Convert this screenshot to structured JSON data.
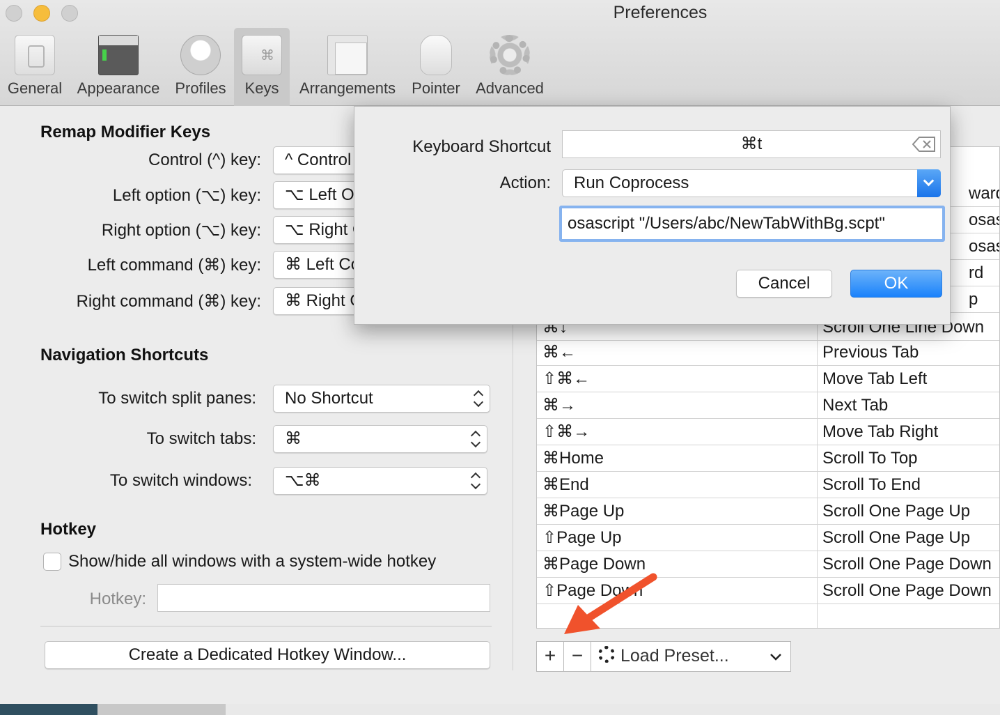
{
  "window": {
    "title": "Preferences"
  },
  "toolbar": {
    "items": [
      {
        "label": "General",
        "icon": "general-icon"
      },
      {
        "label": "Appearance",
        "icon": "appearance-icon"
      },
      {
        "label": "Profiles",
        "icon": "profiles-icon"
      },
      {
        "label": "Keys",
        "icon": "keys-icon",
        "selected": true,
        "glyph": "⌘"
      },
      {
        "label": "Arrangements",
        "icon": "arrangements-icon"
      },
      {
        "label": "Pointer",
        "icon": "pointer-icon"
      },
      {
        "label": "Advanced",
        "icon": "gear-icon"
      }
    ]
  },
  "remap": {
    "title": "Remap Modifier Keys",
    "rows": [
      {
        "label": "Control (^) key:",
        "value": "^ Control"
      },
      {
        "label": "Left option (⌥) key:",
        "value": "⌥ Left Option"
      },
      {
        "label": "Right option (⌥) key:",
        "value": "⌥ Right Option"
      },
      {
        "label": "Left command (⌘) key:",
        "value": "⌘ Left Command"
      },
      {
        "label": "Right command (⌘) key:",
        "value": "⌘ Right Command"
      }
    ]
  },
  "navigation": {
    "title": "Navigation Shortcuts",
    "rows": [
      {
        "label": "To switch split panes:",
        "value": "No Shortcut"
      },
      {
        "label": "To switch tabs:",
        "value": "⌘"
      },
      {
        "label": "To switch windows:",
        "value": "⌥⌘"
      }
    ]
  },
  "hotkey": {
    "title": "Hotkey",
    "checkbox_label": "Show/hide all windows with a system-wide hotkey",
    "field_label": "Hotkey:",
    "field_value": "",
    "dedicated_button": "Create a Dedicated Hotkey Window..."
  },
  "key_table": {
    "partial_rows": [
      {
        "key": "",
        "action": "ward"
      },
      {
        "key": "",
        "action": "osas"
      },
      {
        "key": "",
        "action": "osas"
      },
      {
        "key": "",
        "action": "rd"
      },
      {
        "key": "",
        "action": "p"
      },
      {
        "key": "⌘↓",
        "action": "Scroll One Line Down"
      }
    ],
    "rows": [
      {
        "key": "⌘←",
        "action": "Previous Tab"
      },
      {
        "key": "⇧⌘←",
        "action": "Move Tab Left"
      },
      {
        "key": "⌘→",
        "action": "Next Tab"
      },
      {
        "key": "⇧⌘→",
        "action": "Move Tab Right"
      },
      {
        "key": "⌘Home",
        "action": "Scroll To Top"
      },
      {
        "key": "⌘End",
        "action": "Scroll To End"
      },
      {
        "key": "⌘Page Up",
        "action": "Scroll One Page Up"
      },
      {
        "key": "⇧Page Up",
        "action": "Scroll One Page Up"
      },
      {
        "key": "⌘Page Down",
        "action": "Scroll One Page Down"
      },
      {
        "key": "⇧Page Down",
        "action": "Scroll One Page Down"
      }
    ]
  },
  "table_controls": {
    "add": "+",
    "remove": "−",
    "load_preset": "Load Preset..."
  },
  "sheet": {
    "shortcut_label": "Keyboard Shortcut",
    "shortcut_value": "⌘t",
    "action_label": "Action:",
    "action_value": "Run Coprocess",
    "command_value": "osascript \"/Users/abc/NewTabWithBg.scpt\"",
    "cancel": "Cancel",
    "ok": "OK"
  },
  "colors": {
    "accent": "#1a82fb",
    "annotation_arrow": "#f0522c"
  }
}
